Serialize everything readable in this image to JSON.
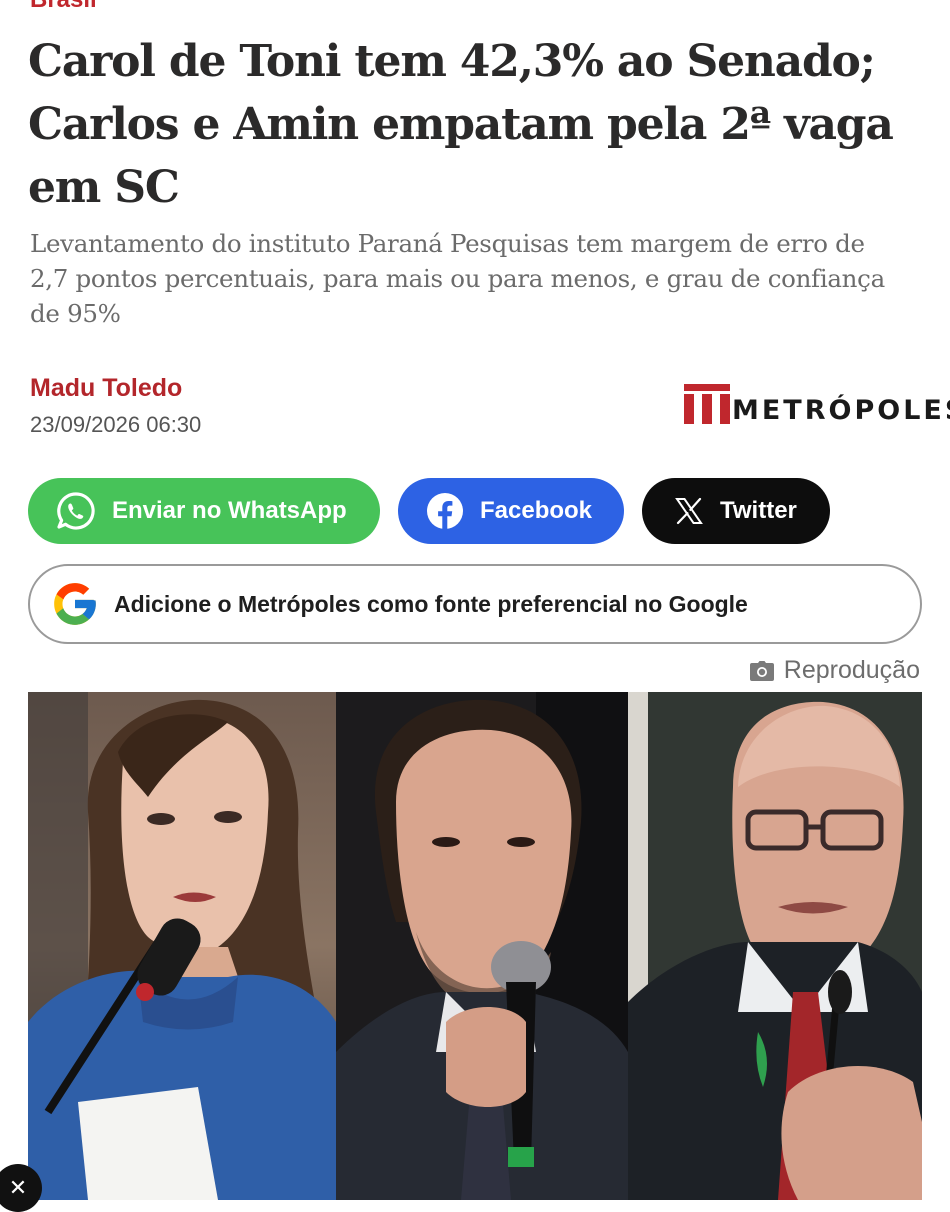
{
  "article": {
    "section": "Brasil",
    "headline": "Carol de Toni tem 42,3% ao Senado; Carlos e Amin empatam pela 2ª vaga em SC",
    "subtitle": "Levantamento do instituto Paraná Pesquisas tem margem de erro de 2,7 pontos percentuais, para mais ou para menos, e grau de confiança de 95%",
    "author": "Madu Toledo",
    "datetime": "23/09/2026 06:30",
    "image_credit": "Reprodução"
  },
  "brand": {
    "name": "METRÓPOLES",
    "color": "#c0272d"
  },
  "share": {
    "whatsapp_label": "Enviar no WhatsApp",
    "facebook_label": "Facebook",
    "twitter_label": "Twitter",
    "whatsapp_color": "#47c359",
    "facebook_color": "#2d62e4",
    "twitter_color": "#0d0d0d"
  },
  "google": {
    "label": "Adicione o Metrópoles como fonte preferencial no Google"
  },
  "overlay": {
    "close_glyph": "✕"
  }
}
